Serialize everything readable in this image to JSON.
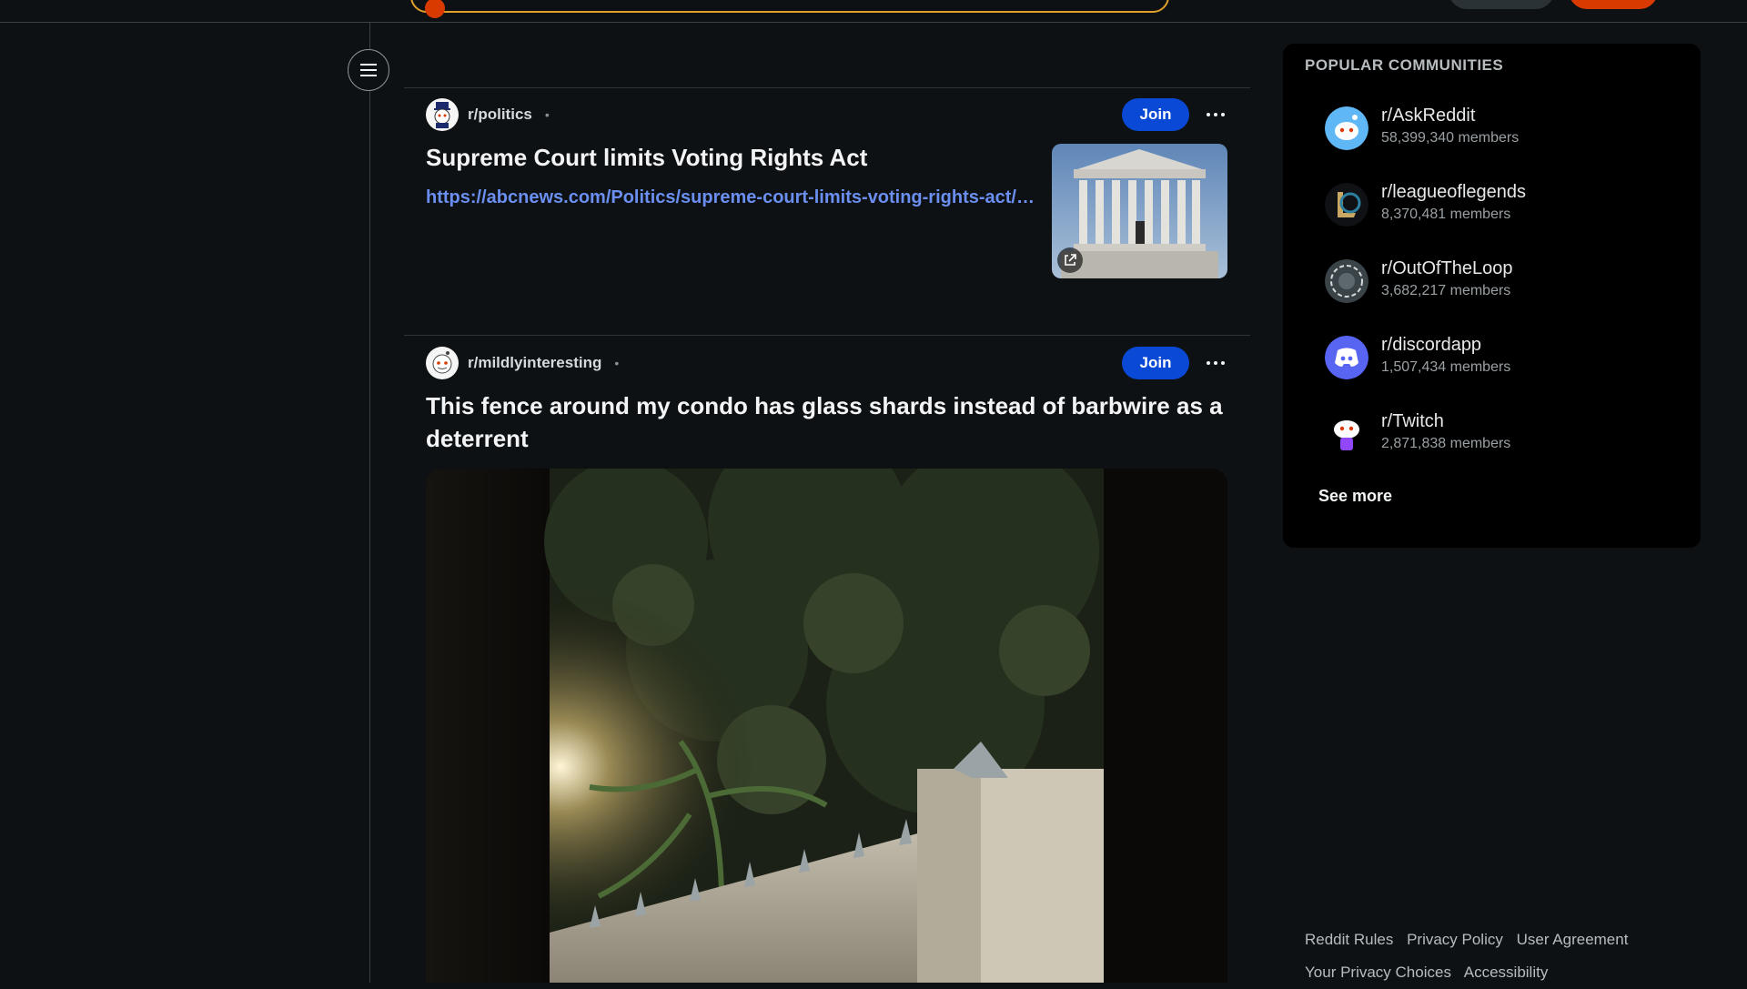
{
  "posts": [
    {
      "subreddit": "r/politics",
      "separator": "•",
      "join_label": "Join",
      "title": "Supreme Court limits Voting Rights Act",
      "link": "https://abcnews.com/Politics/supreme-court-limits-voting-rights-act/story"
    },
    {
      "subreddit": "r/mildlyinteresting",
      "separator": "•",
      "join_label": "Join",
      "title": "This fence around my condo has glass shards instead of barbwire as a deterrent"
    }
  ],
  "sidebar": {
    "heading": "POPULAR COMMUNITIES",
    "communities": [
      {
        "name": "r/AskReddit",
        "members": "58,399,340 members"
      },
      {
        "name": "r/leagueoflegends",
        "members": "8,370,481 members"
      },
      {
        "name": "r/OutOfTheLoop",
        "members": "3,682,217 members"
      },
      {
        "name": "r/discordapp",
        "members": "1,507,434 members"
      },
      {
        "name": "r/Twitch",
        "members": "2,871,838 members"
      }
    ],
    "see_more": "See more"
  },
  "footer": {
    "reddit_rules": "Reddit Rules",
    "privacy_policy": "Privacy Policy",
    "user_agreement": "User Agreement",
    "privacy_choices": "Your Privacy Choices",
    "accessibility": "Accessibility"
  },
  "colors": {
    "background": "#0e1113",
    "join_button": "#0a49d6",
    "link": "#6a8ff0",
    "accent_orange": "#d93a00"
  },
  "icons": {
    "rail_toggle": "hamburger-menu-icon",
    "more": "overflow-menu-icon",
    "external_link": "external-link-icon"
  }
}
